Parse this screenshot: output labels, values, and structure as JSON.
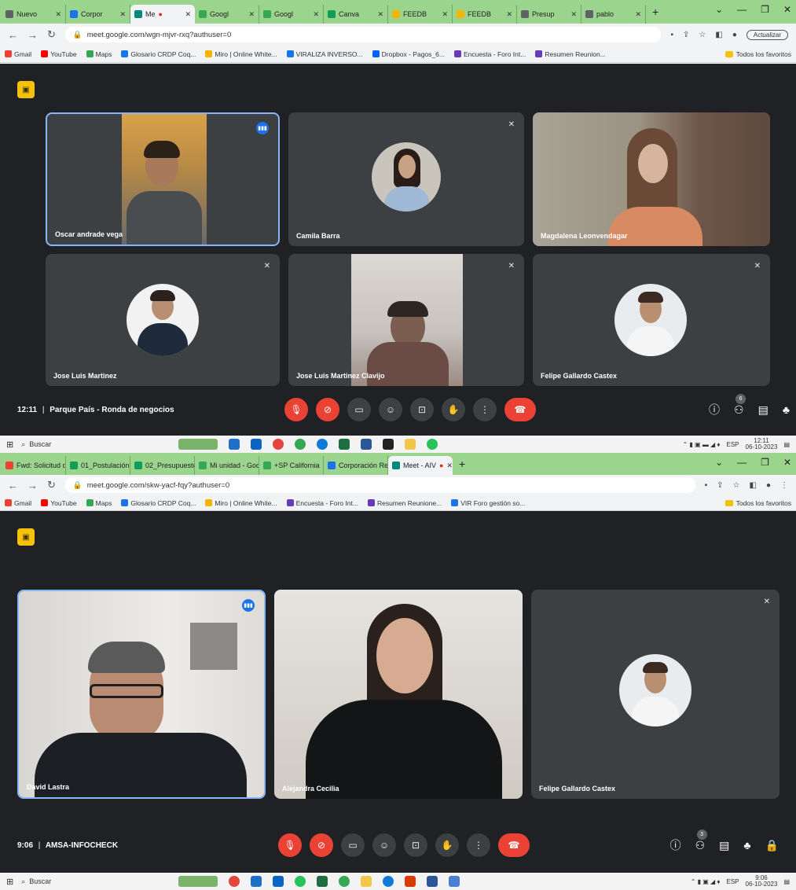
{
  "shot1": {
    "tabs": [
      {
        "label": "Nuevo",
        "color": "#5f6368"
      },
      {
        "label": "Corpor",
        "color": "#1a73e8"
      },
      {
        "label": "Me",
        "color": "#00897b",
        "active": true,
        "recording": "●"
      },
      {
        "label": "Googl",
        "color": "#34a853"
      },
      {
        "label": "Googl",
        "color": "#34a853"
      },
      {
        "label": "Canva",
        "color": "#0f9d58"
      },
      {
        "label": "FEEDB",
        "color": "#f4b400"
      },
      {
        "label": "FEEDB",
        "color": "#f4b400"
      },
      {
        "label": "Presup",
        "color": "#5f6368"
      },
      {
        "label": "pablo",
        "color": "#5f6368"
      }
    ],
    "url": "meet.google.com/wgn-mjvr-rxq?authuser=0",
    "update_label": "Actualizar",
    "bookmarks": [
      {
        "label": "Gmail",
        "color": "#ea4335"
      },
      {
        "label": "YouTube",
        "color": "#ff0000"
      },
      {
        "label": "Maps",
        "color": "#34a853"
      },
      {
        "label": "Glosario CRDP Coq...",
        "color": "#1a73e8"
      },
      {
        "label": "Miro | Online White...",
        "color": "#f4b400"
      },
      {
        "label": "VIRALIZA INVERSO...",
        "color": "#1a73e8"
      },
      {
        "label": "Dropbox - Pagos_6...",
        "color": "#0061ff"
      },
      {
        "label": "Encuesta - Foro Int...",
        "color": "#673ab7"
      },
      {
        "label": "Resumen Reunion...",
        "color": "#673ab7"
      }
    ],
    "bookmarks_folder": "Todos los favoritos",
    "participants": [
      {
        "name": "Oscar andrade vega",
        "speaking": true
      },
      {
        "name": "Camila Barra"
      },
      {
        "name": "Magdalena Leonvendagar"
      },
      {
        "name": "Jose Luis Martinez"
      },
      {
        "name": "Jose Luis Martinez Clavijo"
      },
      {
        "name": "Felipe Gallardo Castex"
      }
    ],
    "time": "12:11",
    "separator": "|",
    "meeting_name": "Parque País - Ronda de negocios",
    "people_count": "6",
    "taskbar": {
      "search": "Buscar",
      "lang": "ESP",
      "clock_time": "12:11",
      "clock_date": "06-10-2023"
    }
  },
  "shot2": {
    "tabs": [
      {
        "label": "Fwd: Solicitud d",
        "color": "#ea4335"
      },
      {
        "label": "01_Postulación",
        "color": "#0f9d58"
      },
      {
        "label": "02_Presupuesto",
        "color": "#0f9d58"
      },
      {
        "label": "Mi unidad - Goo",
        "color": "#34a853"
      },
      {
        "label": "+SP California",
        "color": "#34a853"
      },
      {
        "label": "Corporación Re",
        "color": "#1a73e8"
      },
      {
        "label": "Meet - AIV",
        "color": "#00897b",
        "active": true,
        "recording": "●"
      }
    ],
    "url": "meet.google.com/skw-yacf-fqy?authuser=0",
    "bookmarks": [
      {
        "label": "Gmail",
        "color": "#ea4335"
      },
      {
        "label": "YouTube",
        "color": "#ff0000"
      },
      {
        "label": "Maps",
        "color": "#34a853"
      },
      {
        "label": "Glosario CRDP Coq...",
        "color": "#1a73e8"
      },
      {
        "label": "Miro | Online White...",
        "color": "#f4b400"
      },
      {
        "label": "Encuesta - Foro Int...",
        "color": "#673ab7"
      },
      {
        "label": "Resumen Reunione...",
        "color": "#673ab7"
      },
      {
        "label": "VIR Foro gestión so...",
        "color": "#1a73e8"
      }
    ],
    "bookmarks_folder": "Todos los favoritos",
    "participants": [
      {
        "name": "David Lastra",
        "speaking": true
      },
      {
        "name": "Alejandra Cecilia"
      },
      {
        "name": "Felipe Gallardo Castex"
      }
    ],
    "time": "9:06",
    "separator": "|",
    "meeting_name": "AMSA-INFOCHECK",
    "people_count": "3",
    "taskbar": {
      "search": "Buscar",
      "lang": "ESP",
      "clock_time": "9:06",
      "clock_date": "06-10-2023"
    }
  },
  "icons": {
    "mic_off": "🎙",
    "cam_off": "⊘",
    "captions": "▭",
    "emoji": "☺",
    "present": "⊡",
    "hand": "✋",
    "more": "⋮",
    "end_call": "☎",
    "info": "ⓘ",
    "people": "👥",
    "chat": "▤",
    "activities": "♣",
    "lock": "🔒",
    "mute_indicator": "✕"
  }
}
